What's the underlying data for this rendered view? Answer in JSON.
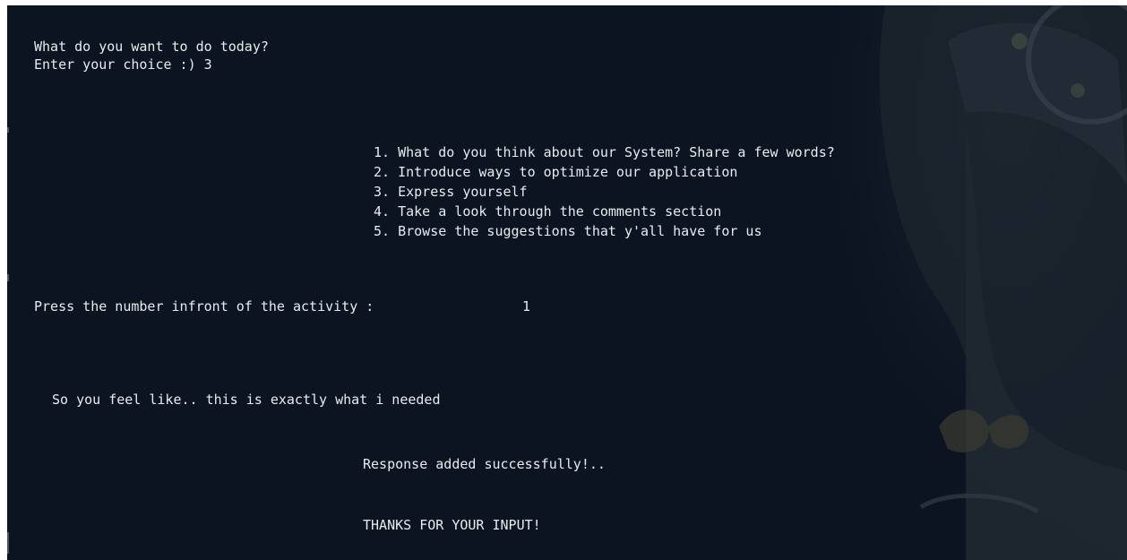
{
  "terminal": {
    "prompt_question": "What do you want to do today?",
    "choice_prompt": "Enter your choice :) ",
    "choice_value": "3",
    "menu_items": [
      "1. What do you think about our System? Share a few words?",
      "2. Introduce ways to optimize our application",
      "3. Express yourself",
      "4. Take a look through the comments section",
      "5. Browse the suggestions that y'all have for us"
    ],
    "activity_prompt": "Press the number infront of the activity :",
    "activity_value": "1",
    "feeling_text": "So you feel like.. this is exactly what i needed",
    "response_message": "Response added successfully!..",
    "thanks_message": "THANKS FOR YOUR INPUT!"
  },
  "colors": {
    "background": "#0b1420",
    "text": "#e8ecef"
  }
}
